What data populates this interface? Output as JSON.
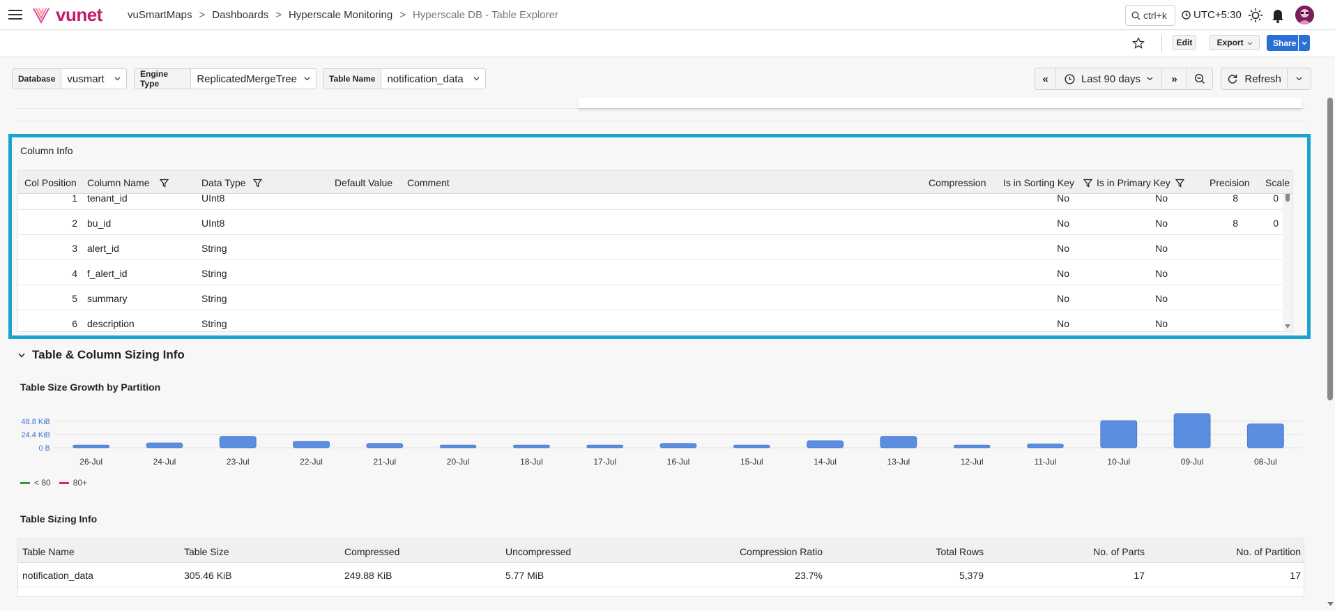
{
  "header": {
    "brand": "vunet",
    "breadcrumbs": [
      "vuSmartMaps",
      "Dashboards",
      "Hyperscale Monitoring"
    ],
    "current_page": "Hyperscale DB - Table Explorer",
    "search_hint": "ctrl+k",
    "timezone": "UTC+5:30"
  },
  "toolbar": {
    "edit_label": "Edit",
    "export_label": "Export",
    "share_label": "Share"
  },
  "filters": {
    "database": {
      "label": "Database",
      "value": "vusmart"
    },
    "engine": {
      "label": "Engine Type",
      "value": "ReplicatedMergeTree"
    },
    "table": {
      "label": "Table Name",
      "value": "notification_data"
    }
  },
  "time": {
    "range_label": "Last 90 days",
    "refresh_label": "Refresh"
  },
  "column_info": {
    "title": "Column Info",
    "headers": [
      "Col Position",
      "Column Name",
      "Data Type",
      "Default Value",
      "Comment",
      "Compression",
      "Is in Sorting Key",
      "Is in Primary Key",
      "Precision",
      "Scale"
    ],
    "rows": [
      {
        "pos": "1",
        "name": "tenant_id",
        "type": "UInt8",
        "sort": "No",
        "primary": "No",
        "precision": "8",
        "scale": "0"
      },
      {
        "pos": "2",
        "name": "bu_id",
        "type": "UInt8",
        "sort": "No",
        "primary": "No",
        "precision": "8",
        "scale": "0"
      },
      {
        "pos": "3",
        "name": "alert_id",
        "type": "String",
        "sort": "No",
        "primary": "No",
        "precision": "",
        "scale": ""
      },
      {
        "pos": "4",
        "name": "f_alert_id",
        "type": "String",
        "sort": "No",
        "primary": "No",
        "precision": "",
        "scale": ""
      },
      {
        "pos": "5",
        "name": "summary",
        "type": "String",
        "sort": "No",
        "primary": "No",
        "precision": "",
        "scale": ""
      },
      {
        "pos": "6",
        "name": "description",
        "type": "String",
        "sort": "No",
        "primary": "No",
        "precision": "",
        "scale": ""
      }
    ]
  },
  "sizing_section": {
    "title": "Table & Column Sizing Info"
  },
  "chart_data": {
    "type": "bar",
    "title": "Table Size Growth by Partition",
    "categories": [
      "26-Jul",
      "24-Jul",
      "23-Jul",
      "22-Jul",
      "21-Jul",
      "20-Jul",
      "18-Jul",
      "17-Jul",
      "16-Jul",
      "15-Jul",
      "14-Jul",
      "13-Jul",
      "12-Jul",
      "11-Jul",
      "10-Jul",
      "09-Jul",
      "08-Jul"
    ],
    "values": [
      5,
      9,
      21,
      12,
      8,
      5,
      5,
      5,
      8,
      5,
      13,
      21,
      5,
      7,
      50,
      63,
      44
    ],
    "unit": "KiB",
    "y_tick_labels": [
      "0 B",
      "24.4 KiB",
      "48.8 KiB"
    ],
    "y_ticks": [
      0,
      24.4,
      48.8
    ],
    "ylim": [
      0,
      48.8
    ],
    "legend": [
      {
        "label": "< 80",
        "color": "#3a9a3a"
      },
      {
        "label": "80+",
        "color": "#d9303a"
      }
    ],
    "bar_color": "#5b8ee0",
    "grid": true
  },
  "table_sizing": {
    "title": "Table Sizing Info",
    "headers": [
      "Table Name",
      "Table Size",
      "Compressed",
      "Uncompressed",
      "Compression Ratio",
      "Total Rows",
      "No. of Parts",
      "No. of Partition"
    ],
    "row": [
      "notification_data",
      "305.46 KiB",
      "249.88 KiB",
      "5.77 MiB",
      "23.7%",
      "5,379",
      "17",
      "17"
    ]
  }
}
